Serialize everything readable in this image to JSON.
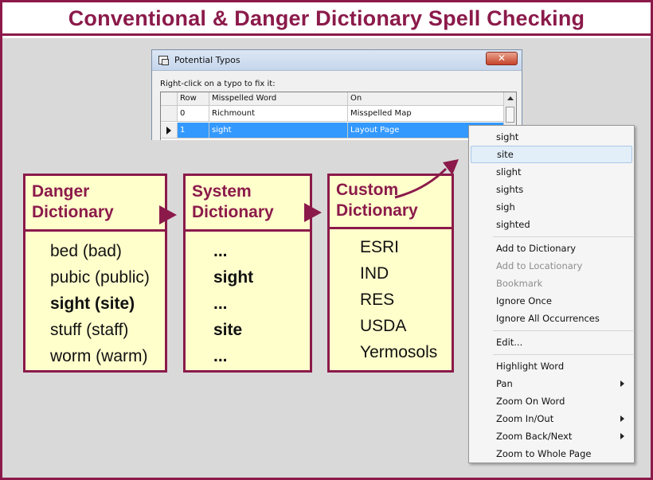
{
  "title": "Conventional & Danger Dictionary Spell Checking",
  "colors": {
    "brand": "#8b1a4a",
    "dict_fill": "#ffffcc",
    "selection": "#3399ff"
  },
  "dialog": {
    "title": "Potential Typos",
    "close_label": "✕",
    "hint": "Right-click on a typo to fix it:",
    "columns": [
      "Row",
      "Misspelled Word",
      "On"
    ],
    "rows": [
      {
        "row": "0",
        "word": "Richmount",
        "on": "Misspelled Map"
      },
      {
        "row": "1",
        "word": "sight",
        "on": "Layout Page",
        "selected": true
      }
    ]
  },
  "dictionaries": [
    {
      "title_line1": "Danger",
      "title_line2": "Dictionary",
      "items": [
        "bed (bad)",
        "pubic (public)",
        "sight (site)",
        "stuff (staff)",
        "worm (warm)"
      ],
      "bold_index": 2
    },
    {
      "title_line1": "System",
      "title_line2": "Dictionary",
      "items": [
        "...",
        "sight",
        "...",
        "site",
        "..."
      ],
      "bold_indices": [
        0,
        1,
        2,
        3,
        4
      ]
    },
    {
      "title_line1": "Custom",
      "title_line2": "Dictionary",
      "items": [
        "ESRI",
        "IND",
        "RES",
        "USDA",
        "Yermosols"
      ]
    }
  ],
  "context_menu": {
    "suggestions": [
      "sight",
      "site",
      "slight",
      "sights",
      "sigh",
      "sighted"
    ],
    "highlighted_suggestion": "site",
    "dictionary_actions": [
      {
        "label": "Add to Dictionary",
        "enabled": true
      },
      {
        "label": "Add to Locationary",
        "enabled": false
      },
      {
        "label": "Bookmark",
        "enabled": false
      },
      {
        "label": "Ignore Once",
        "enabled": true
      },
      {
        "label": "Ignore All Occurrences",
        "enabled": true
      }
    ],
    "edit": "Edit...",
    "view_actions": [
      {
        "label": "Highlight Word",
        "submenu": false
      },
      {
        "label": "Pan",
        "submenu": true
      },
      {
        "label": "Zoom On Word",
        "submenu": false
      },
      {
        "label": "Zoom In/Out",
        "submenu": true
      },
      {
        "label": "Zoom Back/Next",
        "submenu": true
      },
      {
        "label": "Zoom to Whole Page",
        "submenu": false
      }
    ]
  }
}
